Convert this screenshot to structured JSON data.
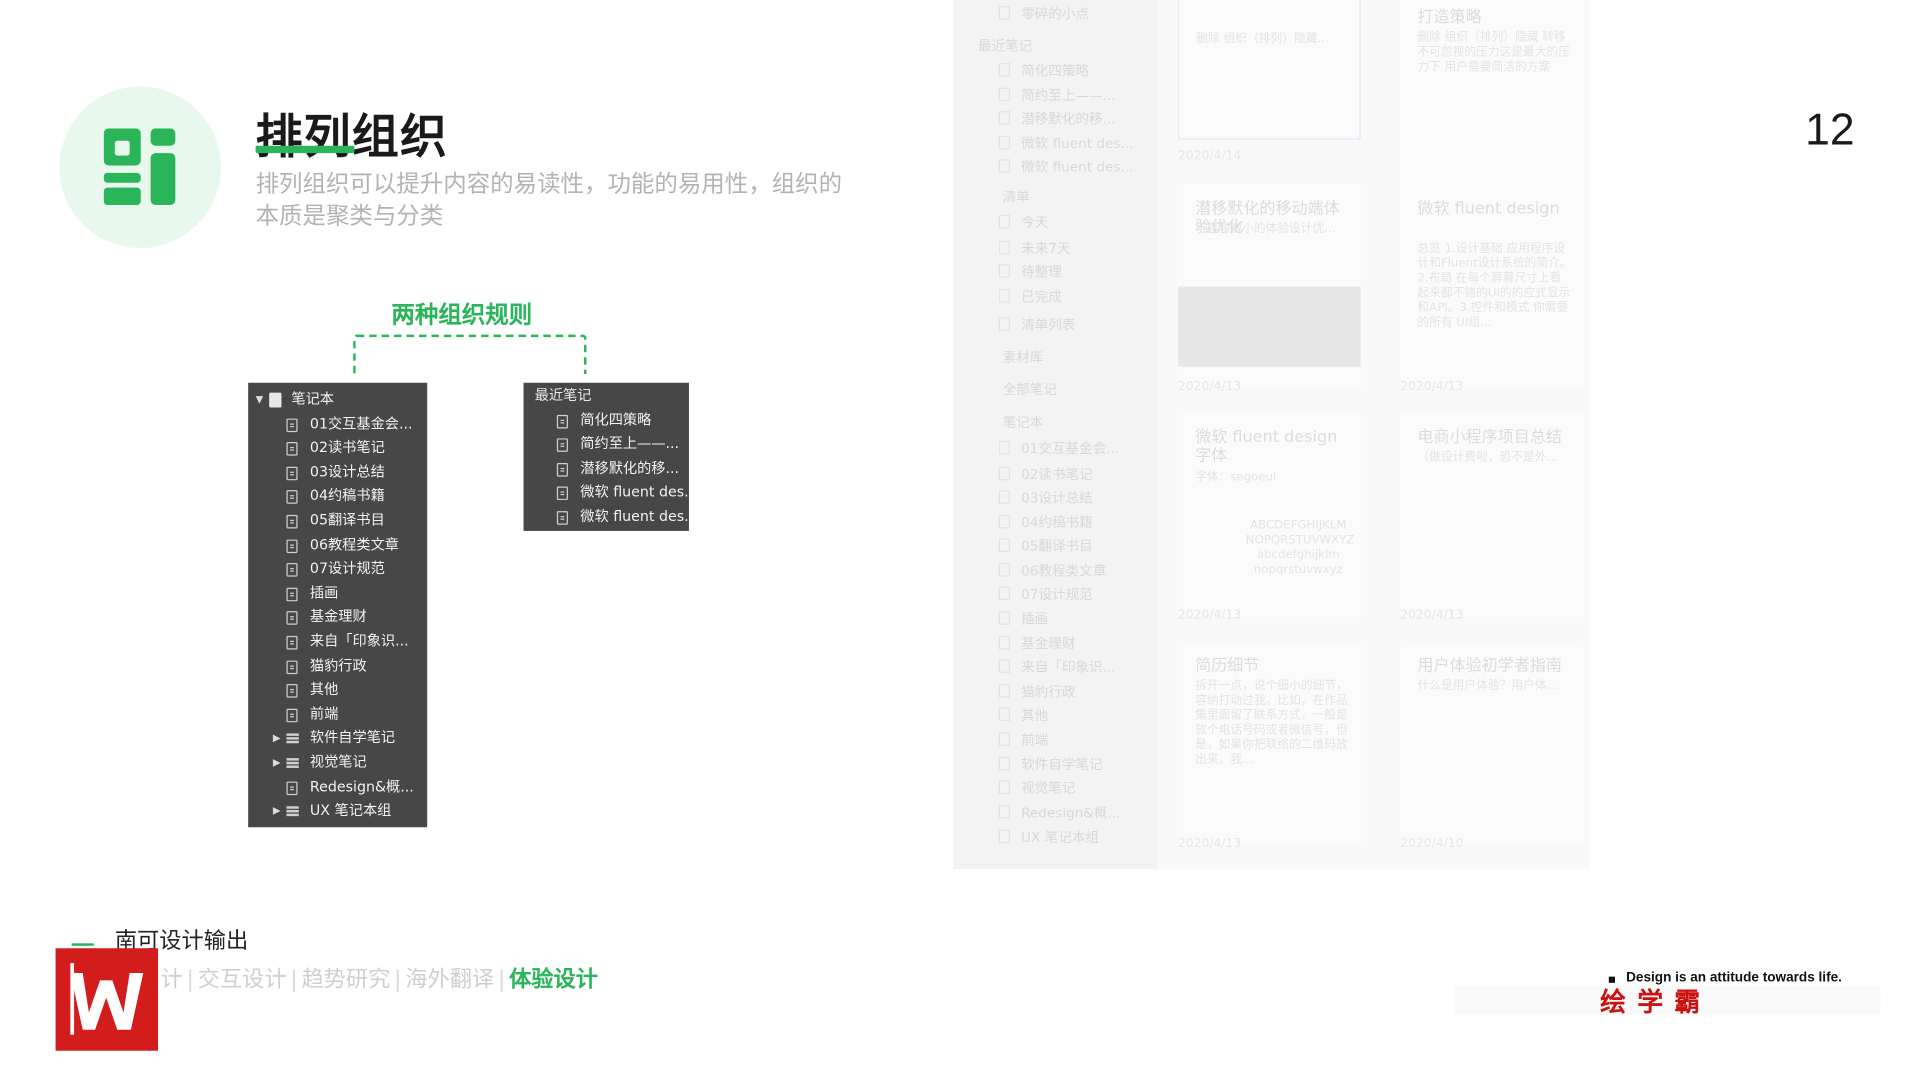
{
  "header": {
    "title": "排列组织",
    "subtitle": "排列组织可以提升内容的易读性，功能的易用性，组织的本质是聚类与分类",
    "page_number": "12",
    "accent_color": "#2bb55a"
  },
  "diagram": {
    "title": "两种组织规则"
  },
  "notebook_panel": {
    "root_label": "笔记本",
    "items": [
      {
        "label": "01交互基金会...",
        "icon": "note-icon",
        "expandable": false
      },
      {
        "label": "02读书笔记",
        "icon": "note-icon",
        "expandable": false
      },
      {
        "label": "03设计总结",
        "icon": "note-icon",
        "expandable": false
      },
      {
        "label": "04约稿书籍",
        "icon": "note-icon",
        "expandable": false
      },
      {
        "label": "05翻译书目",
        "icon": "note-icon",
        "expandable": false
      },
      {
        "label": "06教程类文章",
        "icon": "note-icon",
        "expandable": false
      },
      {
        "label": "07设计规范",
        "icon": "note-icon",
        "expandable": false
      },
      {
        "label": "插画",
        "icon": "note-icon",
        "expandable": false
      },
      {
        "label": "基金理财",
        "icon": "note-icon",
        "expandable": false
      },
      {
        "label": "来自「印象识...",
        "icon": "note-icon",
        "expandable": false
      },
      {
        "label": "猫豹行政",
        "icon": "note-icon",
        "expandable": false
      },
      {
        "label": "其他",
        "icon": "note-icon",
        "expandable": false
      },
      {
        "label": "前端",
        "icon": "note-icon",
        "expandable": false
      },
      {
        "label": "软件自学笔记",
        "icon": "stack-icon",
        "expandable": true
      },
      {
        "label": "视觉笔记",
        "icon": "stack-icon",
        "expandable": true
      },
      {
        "label": "Redesign&概...",
        "icon": "note-icon",
        "expandable": false
      },
      {
        "label": "UX 笔记本组",
        "icon": "stack-icon",
        "expandable": true
      }
    ]
  },
  "recent_panel": {
    "header_label": "最近笔记",
    "items": [
      {
        "label": "简化四策略"
      },
      {
        "label": "简约至上——..."
      },
      {
        "label": "潜移默化的移..."
      },
      {
        "label": "微软 fluent des..."
      },
      {
        "label": "微软 fluent des..."
      }
    ]
  },
  "background_app": {
    "sidebar": [
      {
        "label": "零碎的小点",
        "head": false
      },
      {
        "label": "最近笔记",
        "head": true
      },
      {
        "label": "简化四策略",
        "head": false
      },
      {
        "label": "简约至上——...",
        "head": false
      },
      {
        "label": "潜移默化的移...",
        "head": false
      },
      {
        "label": "微软 fluent des...",
        "head": false
      },
      {
        "label": "微软 fluent des...",
        "head": false
      },
      {
        "label": "清单",
        "head": true
      },
      {
        "label": "今天",
        "head": false
      },
      {
        "label": "未来7天",
        "head": false
      },
      {
        "label": "待整理",
        "head": false
      },
      {
        "label": "已完成",
        "head": false
      },
      {
        "label": "清单列表",
        "head": false
      },
      {
        "label": "素材库",
        "head": true
      },
      {
        "label": "全部笔记",
        "head": true
      },
      {
        "label": "笔记本",
        "head": true
      },
      {
        "label": "01交互基金会...",
        "head": false
      },
      {
        "label": "02读书笔记",
        "head": false
      },
      {
        "label": "03设计总结",
        "head": false
      },
      {
        "label": "04约稿书籍",
        "head": false
      },
      {
        "label": "05翻译书目",
        "head": false
      },
      {
        "label": "06教程类文章",
        "head": false
      },
      {
        "label": "07设计规范",
        "head": false
      },
      {
        "label": "插画",
        "head": false
      },
      {
        "label": "基金理财",
        "head": false
      },
      {
        "label": "来自「印象识...",
        "head": false
      },
      {
        "label": "猫豹行政",
        "head": false
      },
      {
        "label": "其他",
        "head": false
      },
      {
        "label": "前端",
        "head": false
      },
      {
        "label": "软件自学笔记",
        "head": false
      },
      {
        "label": "视觉笔记",
        "head": false
      },
      {
        "label": "Redesign&概...",
        "head": false
      },
      {
        "label": "UX 笔记本组",
        "head": false
      }
    ],
    "cards": [
      {
        "title": "",
        "desc": "删除 组织（排列）隐藏...",
        "date": "2020/4/14"
      },
      {
        "title": "打造策略",
        "desc": "删除 组织（排列）隐藏 转移 不可忽视的压力这是最大的压力下 用户需要简洁的方案",
        "date": "2020/4/14"
      },
      {
        "title": "潜移默化的移动端体验优化",
        "desc": "不容易微小的体验设计优...",
        "date": "2020/4/13"
      },
      {
        "title": "微软 fluent design",
        "desc": "总览 1.设计基础 应用程序设计和Fluent设计系统的简介。2.布局 在每个屏幕尺寸上看起来都不错的UI的的应式显示和API。3.控件和模式 你需要的所有 UI组...",
        "date": "2020/4/13"
      },
      {
        "title": "微软 fluent design 字体",
        "desc": "字体：segoeui",
        "date": "2020/4/13"
      },
      {
        "title": "电商小程序项目总结",
        "desc": "（做设计费啦，恐不是外...",
        "date": "2020/4/13"
      },
      {
        "title": "简历细节",
        "desc": "拆开一点，说个细小的细节，容纳打动过我。比如，在作品集里面留了联系方式，一般是放个电话号码或者微信号，但是，如果你把联络的二维码放出来，我...",
        "date": "2020/4/13"
      },
      {
        "title": "用户体验初学者指南",
        "desc": "什么是用户体验？用户体...",
        "date": "2020/4/10"
      }
    ],
    "font_sample": "ABCDEFGHIJKLM NOPQRSTUVWXYZ abcdefghijklm nopqrstuvwxyz"
  },
  "footer": {
    "brand": "南可设计输出",
    "nav": [
      "计",
      "交互设计",
      "趋势研究",
      "海外翻译",
      "体验设计"
    ],
    "active_nav": "体验设计",
    "tagline": "Design is an attitude towards life.",
    "watermark": "绘学霸",
    "logo_color": "#d31d1d"
  }
}
